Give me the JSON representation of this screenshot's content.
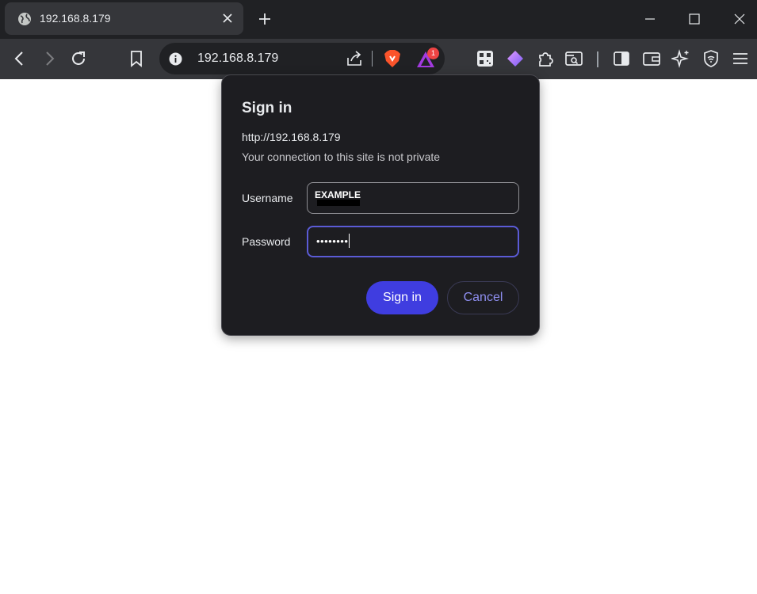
{
  "browser": {
    "tab": {
      "title": "192.168.8.179",
      "favicon": "globe-icon"
    },
    "omnibox": {
      "url": "192.168.8.179",
      "rewards_badge": "1"
    },
    "toolbar_icons": [
      "back-icon",
      "forward-icon",
      "reload-icon",
      "bookmark-icon",
      "qr-code-icon",
      "leo-icon",
      "extensions-icon",
      "search-tab-icon",
      "sidebar-icon",
      "wallet-icon",
      "ai-sparkle-icon",
      "vpn-icon",
      "menu-icon"
    ]
  },
  "dialog": {
    "title": "Sign in",
    "url": "http://192.168.8.179",
    "note": "Your connection to this site is not private",
    "username_label": "Username",
    "username_value": "EXAMPLE",
    "password_label": "Password",
    "password_value": "••••••••",
    "sign_in_label": "Sign in",
    "cancel_label": "Cancel"
  },
  "colors": {
    "accent": "#3f3de0",
    "dialog_bg": "#1d1d21",
    "toolbar_bg": "#35363a",
    "tabstrip_bg": "#202124"
  }
}
